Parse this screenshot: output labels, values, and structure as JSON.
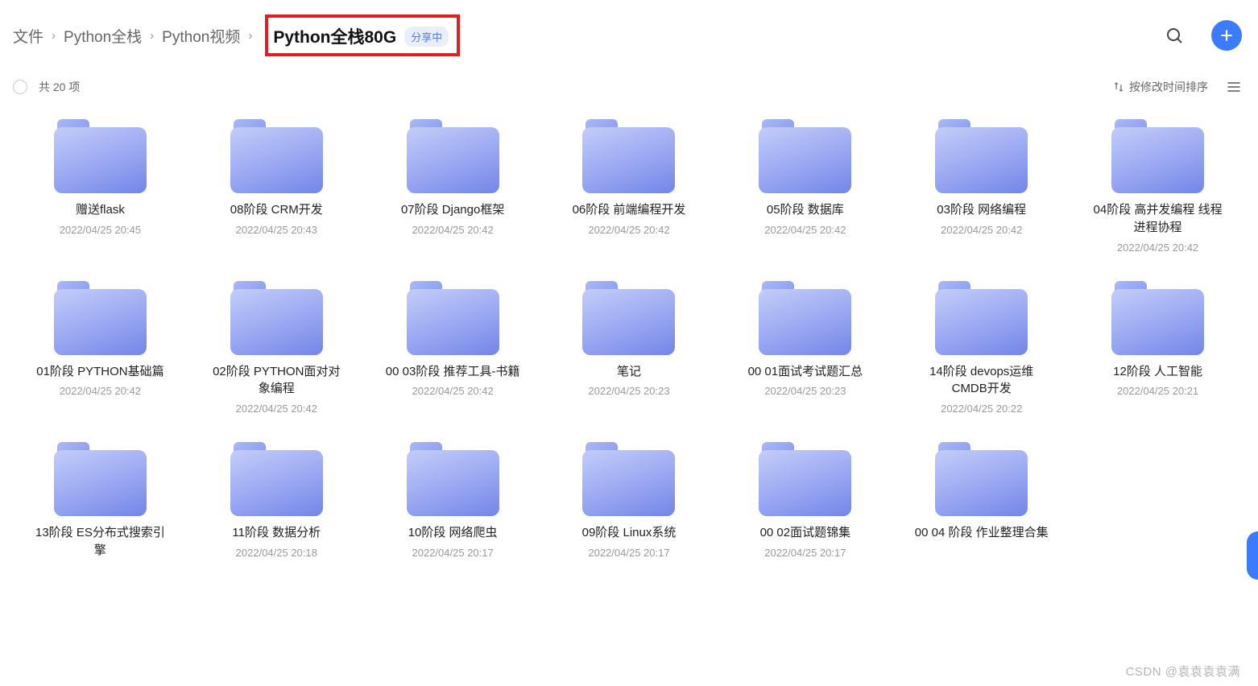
{
  "breadcrumb": {
    "items": [
      "文件",
      "Python全栈",
      "Python视频"
    ],
    "current": "Python全栈80G",
    "share_badge": "分享中"
  },
  "toolbar": {
    "count_label": "共 20 项",
    "sort_label": "按修改时间排序"
  },
  "folders": [
    {
      "name": "赠送flask",
      "date": "2022/04/25 20:45"
    },
    {
      "name": "08阶段 CRM开发",
      "date": "2022/04/25 20:43"
    },
    {
      "name": "07阶段 Django框架",
      "date": "2022/04/25 20:42"
    },
    {
      "name": "06阶段 前端编程开发",
      "date": "2022/04/25 20:42"
    },
    {
      "name": "05阶段 数据库",
      "date": "2022/04/25 20:42"
    },
    {
      "name": "03阶段 网络编程",
      "date": "2022/04/25 20:42"
    },
    {
      "name": "04阶段 高并发编程 线程进程协程",
      "date": "2022/04/25 20:42"
    },
    {
      "name": "01阶段 PYTHON基础篇",
      "date": "2022/04/25 20:42"
    },
    {
      "name": "02阶段 PYTHON面对对象编程",
      "date": "2022/04/25 20:42"
    },
    {
      "name": "00 03阶段 推荐工具-书籍",
      "date": "2022/04/25 20:42"
    },
    {
      "name": "笔记",
      "date": "2022/04/25 20:23"
    },
    {
      "name": "00 01面试考试题汇总",
      "date": "2022/04/25 20:23"
    },
    {
      "name": "14阶段 devops运维CMDB开发",
      "date": "2022/04/25 20:22"
    },
    {
      "name": "12阶段 人工智能",
      "date": "2022/04/25 20:21"
    },
    {
      "name": "13阶段 ES分布式搜索引擎",
      "date": ""
    },
    {
      "name": "11阶段 数据分析",
      "date": "2022/04/25 20:18"
    },
    {
      "name": "10阶段 网络爬虫",
      "date": "2022/04/25 20:17"
    },
    {
      "name": "09阶段 Linux系统",
      "date": "2022/04/25 20:17"
    },
    {
      "name": "00 02面试题锦集",
      "date": "2022/04/25 20:17"
    },
    {
      "name": "00 04 阶段 作业整理合集",
      "date": ""
    }
  ],
  "watermark": "CSDN @袁袁袁袁满"
}
